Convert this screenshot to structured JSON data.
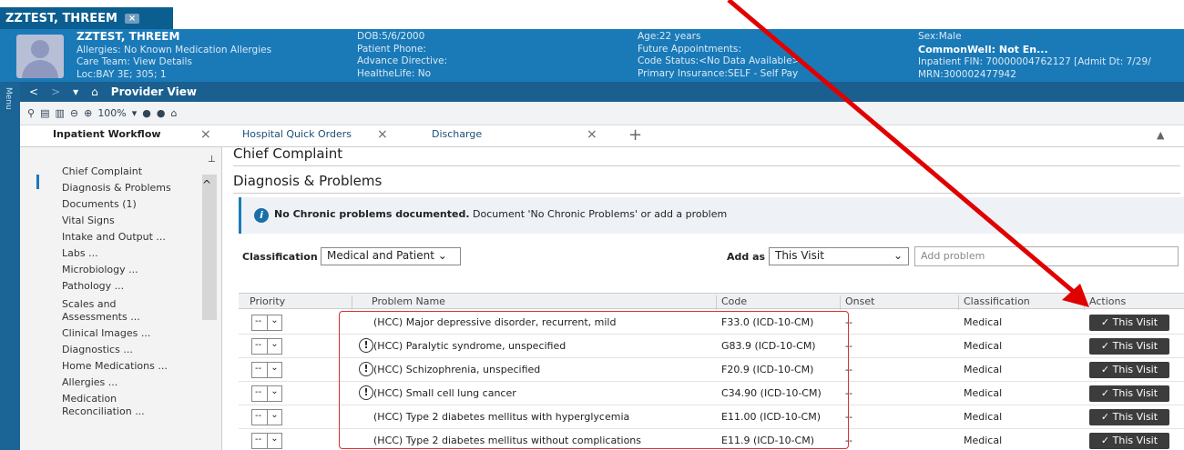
{
  "window": {
    "tab_title": "ZZTEST, THREEM",
    "close": "×"
  },
  "banner": {
    "name": "ZZTEST, THREEM",
    "allergies": "Allergies: No Known Medication Allergies",
    "care_team": "Care Team: View Details",
    "loc": "Loc:BAY 3E; 305; 1",
    "dob": "DOB:5/6/2000",
    "phone": "Patient Phone:",
    "directive": "Advance Directive:",
    "healthelife": "HealtheLife: No",
    "age": "Age:22 years",
    "future": "Future Appointments:",
    "code_status": "Code Status:<No Data Available>",
    "insurance": "Primary Insurance:SELF - Self Pay",
    "sex": "Sex:Male",
    "commonwell": "CommonWell: Not En...",
    "fin": "Inpatient FIN: 70000004762127 [Admit Dt: 7/29/",
    "mrn": "MRN:300002477942"
  },
  "menu_label": "Menu",
  "nav": {
    "back": "<",
    "fwd": ">",
    "title": "Provider View"
  },
  "toolbar": {
    "zoom": "100%"
  },
  "tabs": [
    {
      "label": "Inpatient Workflow"
    },
    {
      "label": "Hospital Quick Orders"
    },
    {
      "label": "Discharge"
    }
  ],
  "sidebar": {
    "items": [
      "Chief Complaint",
      "Diagnosis & Problems",
      "Documents (1)",
      "Vital Signs",
      "Intake and Output ...",
      "Labs ...",
      "Microbiology ...",
      "Pathology ...",
      "Scales and",
      "Assessments ...",
      "Clinical Images ...",
      "Diagnostics ...",
      "Home Medications ...",
      "Allergies ...",
      "Medication",
      "Reconciliation ..."
    ]
  },
  "main": {
    "chief_complaint": "Chief Complaint",
    "section_title": "Diagnosis & Problems",
    "info_bold": "No Chronic problems documented.",
    "info_text": "Document 'No Chronic Problems' or add a problem",
    "classification_label": "Classification",
    "classification_value": "Medical and Patient",
    "add_as_label": "Add as",
    "add_as_value": "This Visit",
    "add_problem_placeholder": "Add problem",
    "headers": {
      "priority": "Priority",
      "name": "Problem Name",
      "code": "Code",
      "onset": "Onset",
      "classification": "Classification",
      "actions": "Actions"
    },
    "rows": [
      {
        "priority": "--",
        "warn": false,
        "name": "(HCC) Major depressive disorder, recurrent, mild",
        "code": "F33.0 (ICD-10-CM)",
        "onset": "--",
        "classification": "Medical",
        "action": "This Visit"
      },
      {
        "priority": "--",
        "warn": true,
        "name": "(HCC) Paralytic syndrome, unspecified",
        "code": "G83.9 (ICD-10-CM)",
        "onset": "--",
        "classification": "Medical",
        "action": "This Visit"
      },
      {
        "priority": "--",
        "warn": true,
        "name": "(HCC) Schizophrenia, unspecified",
        "code": "F20.9 (ICD-10-CM)",
        "onset": "--",
        "classification": "Medical",
        "action": "This Visit"
      },
      {
        "priority": "--",
        "warn": true,
        "name": "(HCC) Small cell lung cancer",
        "code": "C34.90 (ICD-10-CM)",
        "onset": "--",
        "classification": "Medical",
        "action": "This Visit"
      },
      {
        "priority": "--",
        "warn": false,
        "name": "(HCC) Type 2 diabetes mellitus with hyperglycemia",
        "code": "E11.00 (ICD-10-CM)",
        "onset": "--",
        "classification": "Medical",
        "action": "This Visit"
      },
      {
        "priority": "--",
        "warn": false,
        "name": "(HCC) Type 2 diabetes mellitus without complications",
        "code": "E11.9 (ICD-10-CM)",
        "onset": "--",
        "classification": "Medical",
        "action": "This Visit"
      }
    ]
  },
  "colors": {
    "banner": "#1a7ab8",
    "nav": "#1a5f8f",
    "annotation": "#e00000"
  }
}
